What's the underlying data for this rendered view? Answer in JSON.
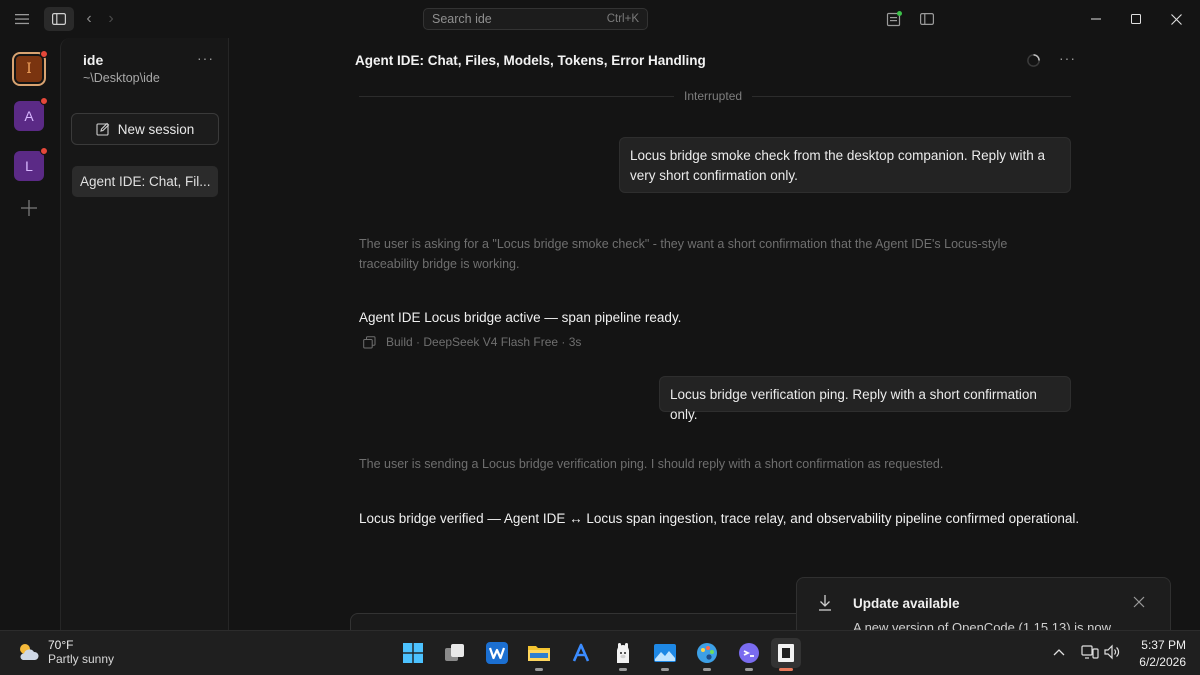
{
  "titlebar": {
    "search_placeholder": "Search ide",
    "search_shortcut": "Ctrl+K"
  },
  "rail": {
    "projects": [
      {
        "initial": "I",
        "has_alert": true
      },
      {
        "initial": "A",
        "has_alert": true
      },
      {
        "initial": "L",
        "has_alert": true
      }
    ]
  },
  "sidebar": {
    "project_name": "ide",
    "project_path": "~\\Desktop\\ide",
    "new_session_label": "New session",
    "sessions": [
      {
        "title": "Agent IDE: Chat, Fil..."
      }
    ]
  },
  "chat": {
    "title": "Agent IDE: Chat, Files, Models, Tokens, Error Handling",
    "status_divider": "Interrupted",
    "messages": [
      {
        "role": "user",
        "text": "Locus bridge smoke check from the desktop companion. Reply with a very short confirmation only."
      },
      {
        "role": "reasoning",
        "text": "The user is asking for a \"Locus bridge smoke check\" - they want a short confirmation that the Agent IDE's Locus-style traceability bridge is working."
      },
      {
        "role": "assistant",
        "text": "Agent IDE Locus bridge active — span pipeline ready.",
        "meta": "Build · DeepSeek V4 Flash Free · 3s"
      },
      {
        "role": "user",
        "text": "Locus bridge verification ping. Reply with a short confirmation only."
      },
      {
        "role": "reasoning",
        "text": "The user is sending a Locus bridge verification ping. I should reply with a short confirmation as requested."
      },
      {
        "role": "assistant",
        "text": "Locus bridge verified — Agent IDE ↔ Locus span ingestion, trace relay, and observability pipeline confirmed operational."
      }
    ]
  },
  "toast": {
    "title": "Update available",
    "body": "A new version of OpenCode (1.15.13) is now"
  },
  "taskbar": {
    "weather_temp": "70°F",
    "weather_condition": "Partly sunny",
    "time": "5:37 PM",
    "date": "6/2/2026"
  },
  "colors": {
    "accent_orange": "#e8785a",
    "alert_red": "#e5483a",
    "project_purple": "#5b2a86"
  }
}
